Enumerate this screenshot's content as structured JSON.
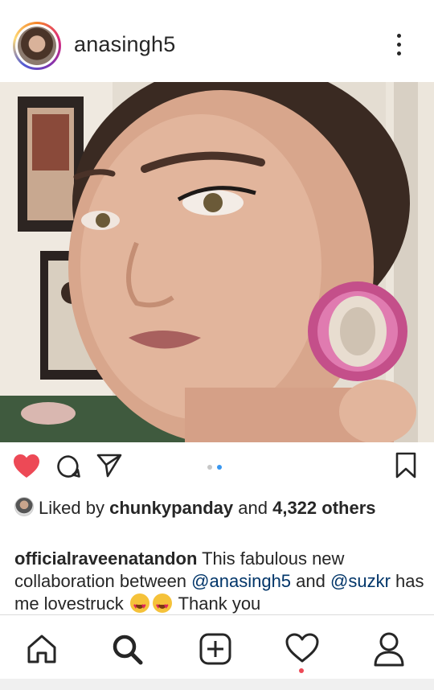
{
  "post": {
    "username": "anasingh5",
    "likes": {
      "prefix": "Liked by",
      "user": "chunkypanday",
      "joiner": "and",
      "count": "4,322",
      "suffix": "others"
    },
    "caption": {
      "author": "officialraveenatandon",
      "text_1": "This fabulous new collaboration between",
      "mention_1": "@anasingh5",
      "text_2": "and",
      "mention_2": "@suzkr",
      "text_3": "has me lovestruck",
      "text_4": "Thank you"
    },
    "carousel": {
      "total": 2,
      "active": 2
    },
    "liked": true
  },
  "icons": {
    "like": "heart-filled-icon",
    "comment": "comment-icon",
    "share": "send-icon",
    "save": "bookmark-icon",
    "nav": [
      "home-icon",
      "search-icon",
      "add-post-icon",
      "activity-heart-icon",
      "profile-icon"
    ]
  },
  "colors": {
    "like_red": "#ed4956",
    "carousel_active": "#3897f0",
    "mention_blue": "#003569"
  }
}
